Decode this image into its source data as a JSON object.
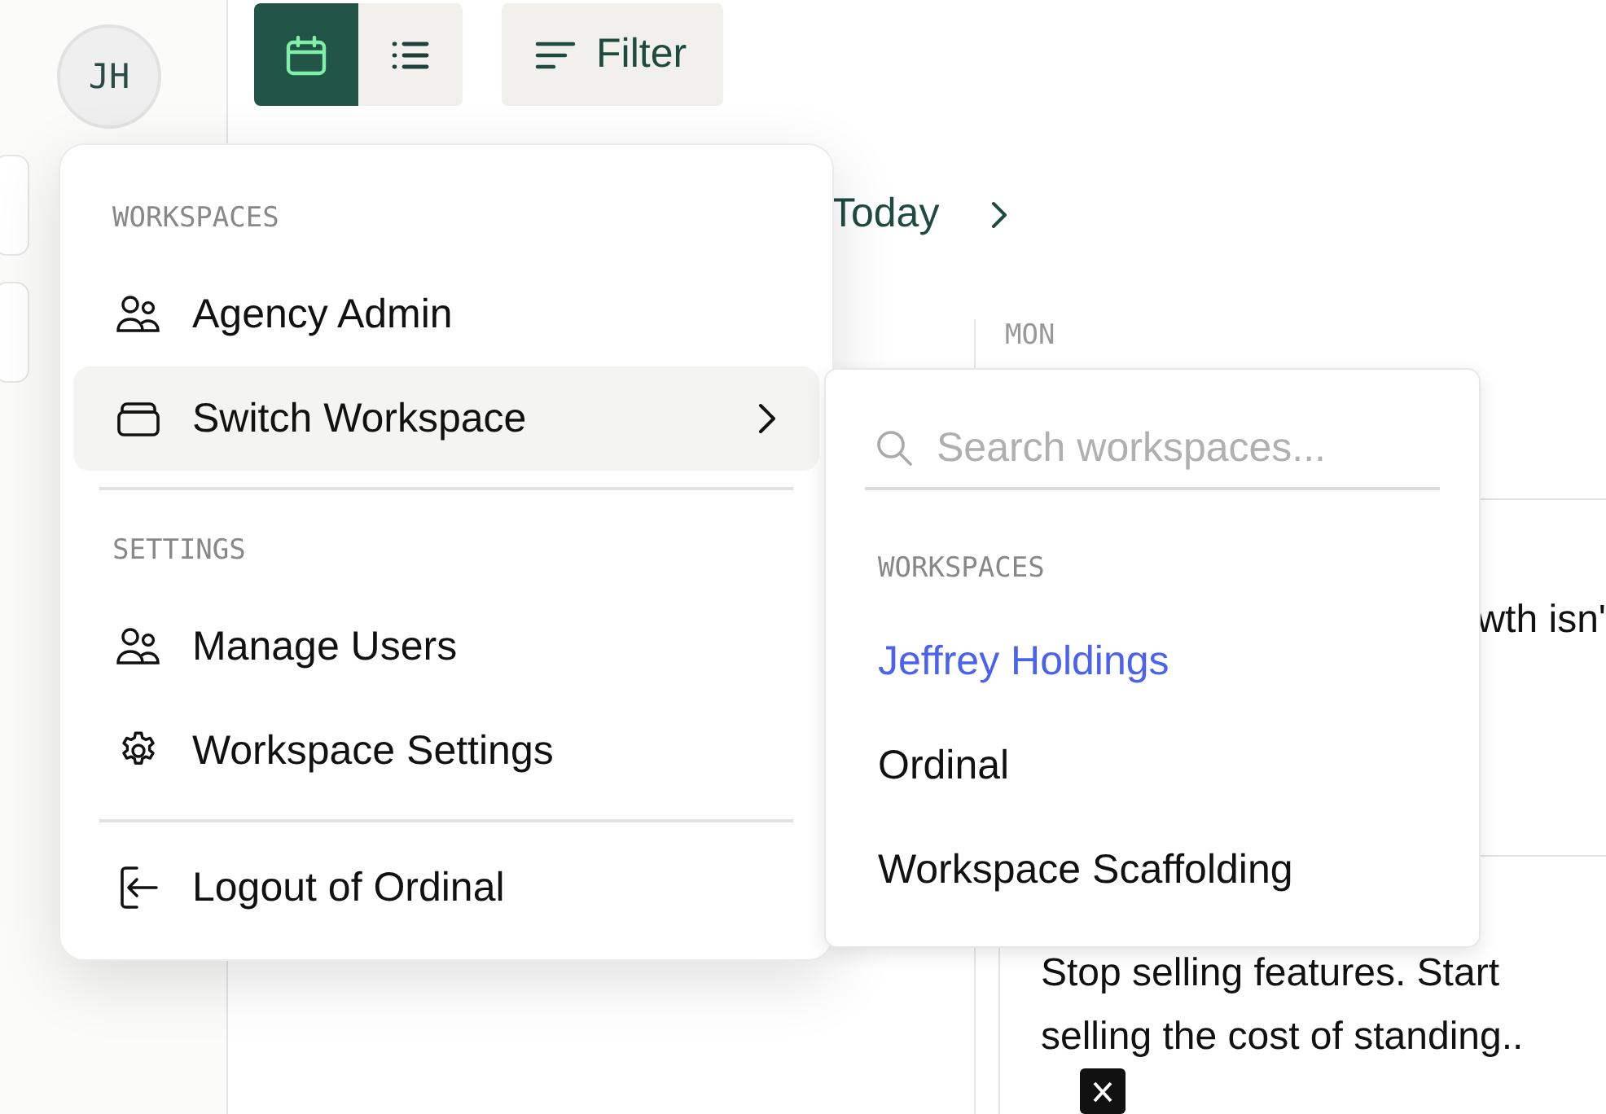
{
  "sidebar": {
    "avatar": "JH"
  },
  "toolbar": {
    "view_toggle": [
      {
        "kind": "calendar",
        "selected": true
      },
      {
        "kind": "list",
        "selected": false
      }
    ],
    "filter": "Filter"
  },
  "date_nav": {
    "label": "Today"
  },
  "calendar": {
    "day": "MON",
    "cards": [
      {
        "text": "wth isn'"
      },
      {
        "text": "Stop selling features. Start selling the cost of standing.."
      }
    ]
  },
  "account_menu": {
    "sections": [
      {
        "heading": "WORKSPACES",
        "items": [
          {
            "label": "Agency Admin",
            "kind": "users",
            "selected": false,
            "has_submenu": false
          },
          {
            "label": "Switch Workspace",
            "kind": "stack",
            "selected": true,
            "has_submenu": true
          }
        ]
      },
      {
        "heading": "SETTINGS",
        "items": [
          {
            "label": "Manage Users",
            "kind": "users",
            "selected": false,
            "has_submenu": false
          },
          {
            "label": "Workspace Settings",
            "kind": "gear",
            "selected": false,
            "has_submenu": false
          }
        ]
      }
    ],
    "footer": {
      "label": "Logout of Ordinal",
      "kind": "logout"
    }
  },
  "workspace_switcher": {
    "search": {
      "placeholder": "Search workspaces..."
    },
    "heading": "WORKSPACES",
    "items": [
      {
        "label": "Jeffrey Holdings",
        "selected": true
      },
      {
        "label": "Ordinal",
        "selected": false
      },
      {
        "label": "Workspace Scaffolding",
        "selected": false
      }
    ]
  }
}
